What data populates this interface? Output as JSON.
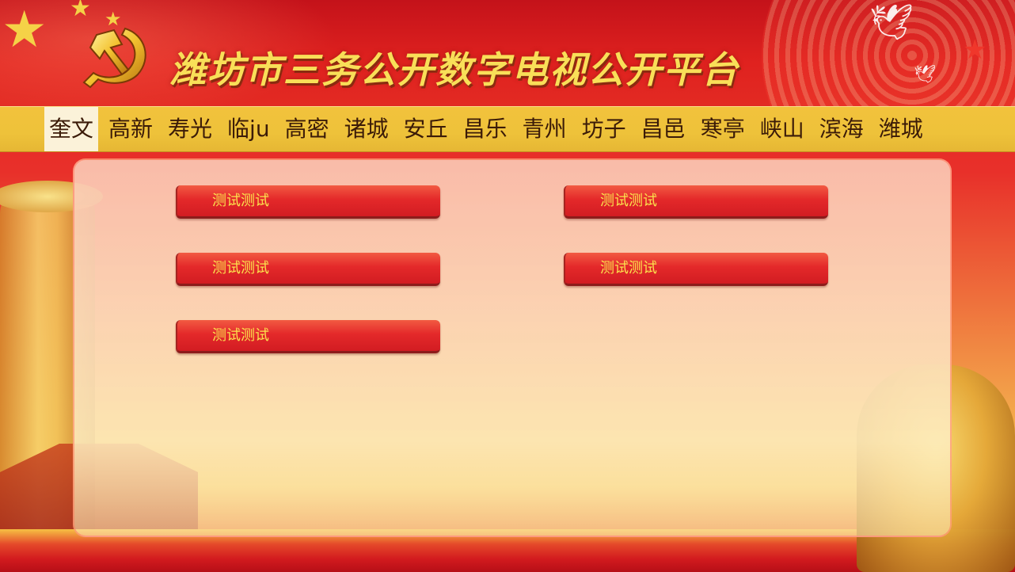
{
  "header": {
    "title": "潍坊市三务公开数字电视公开平台",
    "emblem_icon": "party-emblem-icon",
    "dove_icon": "dove-icon",
    "star_icon": "star-icon"
  },
  "nav": {
    "active_index": 0,
    "items": [
      {
        "label": "奎文"
      },
      {
        "label": "高新"
      },
      {
        "label": "寿光"
      },
      {
        "label": "临ju"
      },
      {
        "label": "高密"
      },
      {
        "label": "诸城"
      },
      {
        "label": "安丘"
      },
      {
        "label": "昌乐"
      },
      {
        "label": "青州"
      },
      {
        "label": "坊子"
      },
      {
        "label": "昌邑"
      },
      {
        "label": "寒亭"
      },
      {
        "label": "峡山"
      },
      {
        "label": "滨海"
      },
      {
        "label": "潍城"
      }
    ]
  },
  "menu": {
    "buttons": [
      {
        "label": "测试测试"
      },
      {
        "label": "测试测试"
      },
      {
        "label": "测试测试"
      },
      {
        "label": "测试测试"
      },
      {
        "label": "测试测试"
      }
    ]
  },
  "colors": {
    "title": "#f9df58",
    "nav_bg": "#f2c23c",
    "nav_active_bg": "#fbf2d9",
    "button_bg": "#e4292a",
    "button_text": "#fbe24d"
  }
}
